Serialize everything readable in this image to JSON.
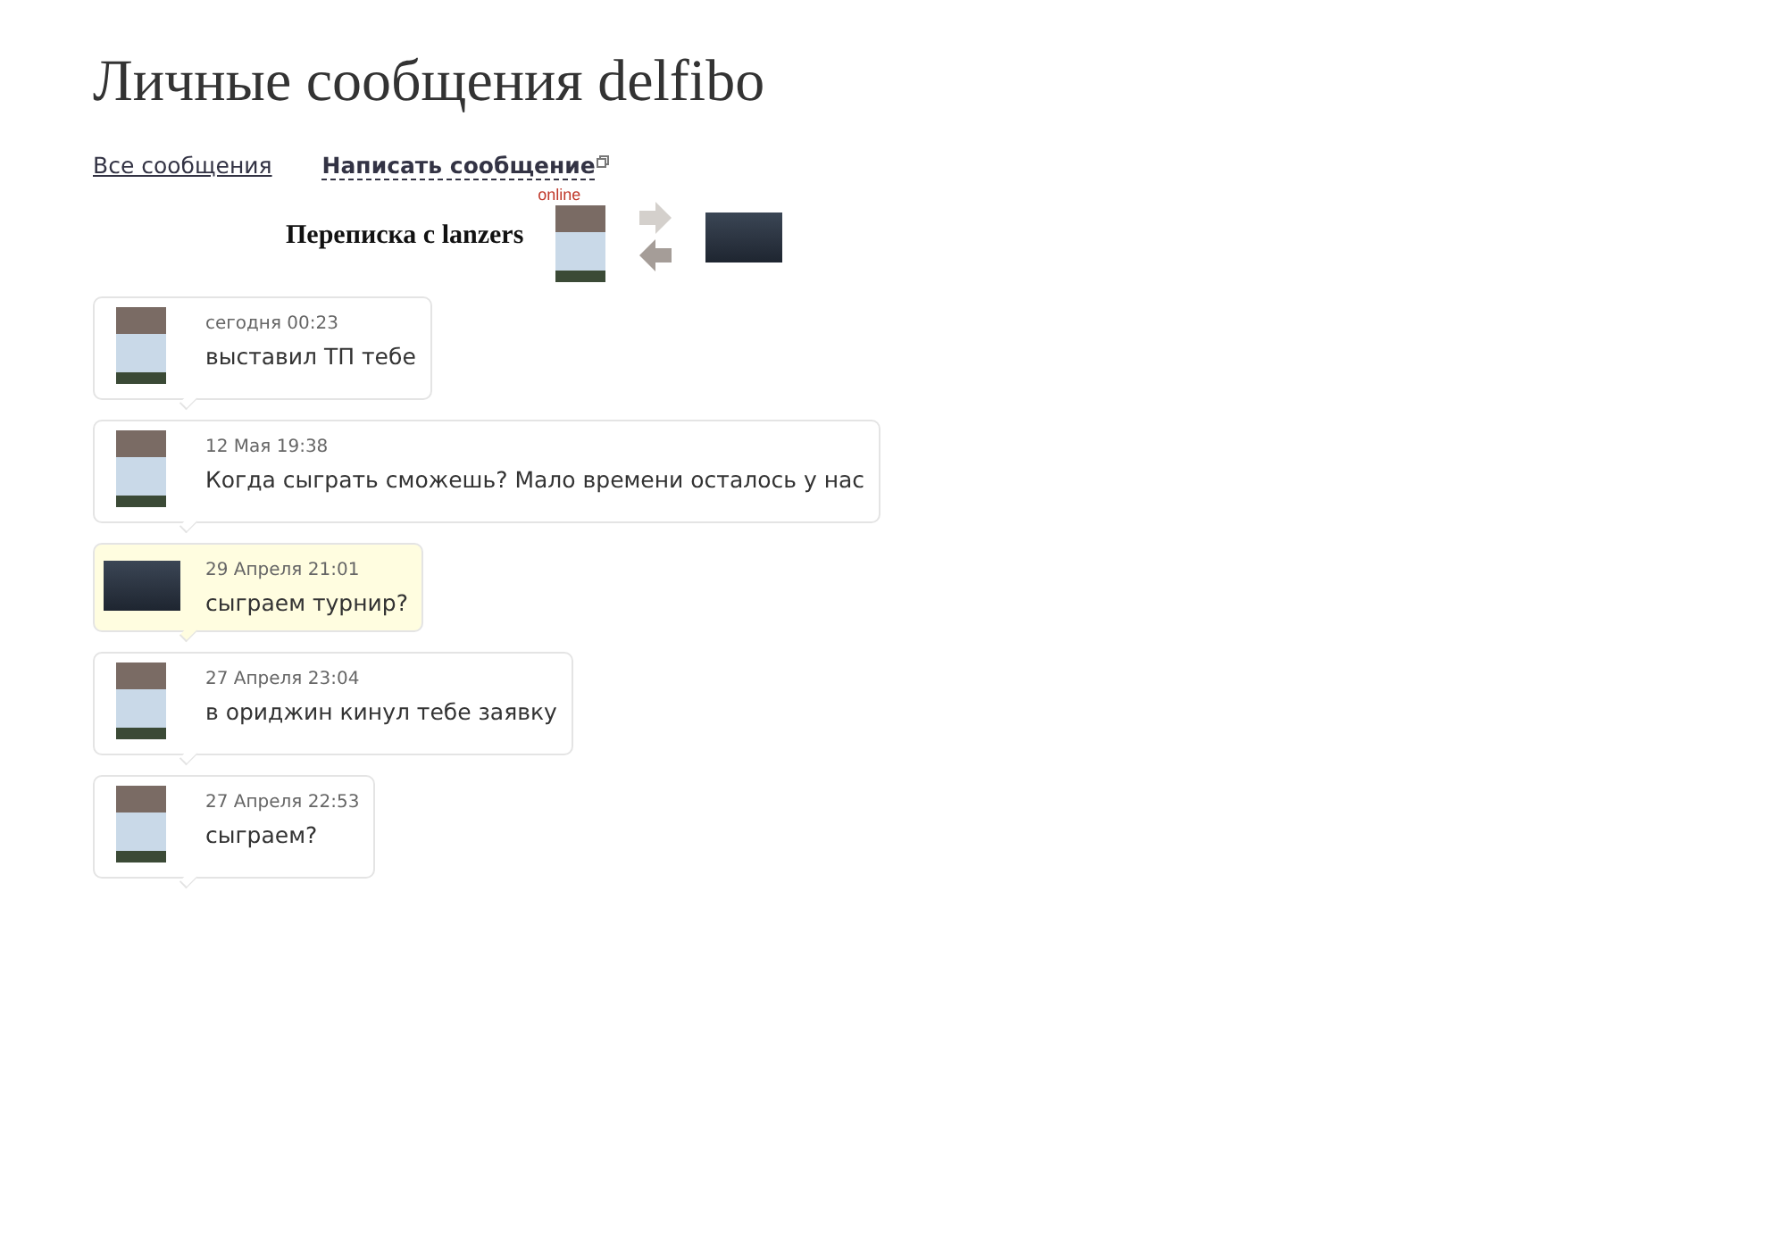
{
  "page_title": "Личные сообщения delfibo",
  "nav": [
    {
      "label": "Все сообщения",
      "kind": "link"
    },
    {
      "label": "Написать сообщение",
      "kind": "action"
    }
  ],
  "conversation": {
    "title": "Переписка с lanzers",
    "partner_status": "online"
  },
  "messages": [
    {
      "mine": false,
      "time": "сегодня 00:23",
      "text": "выставил ТП тебе"
    },
    {
      "mine": false,
      "time": "12 Мая 19:38",
      "text": "Когда сыграть сможешь? Мало времени осталось у нас"
    },
    {
      "mine": true,
      "time": "29 Апреля 21:01",
      "text": "сыграем турнир?"
    },
    {
      "mine": false,
      "time": "27 Апреля 23:04",
      "text": "в ориджин кинул тебе заявку"
    },
    {
      "mine": false,
      "time": "27 Апреля 22:53",
      "text": "сыграем?"
    }
  ]
}
